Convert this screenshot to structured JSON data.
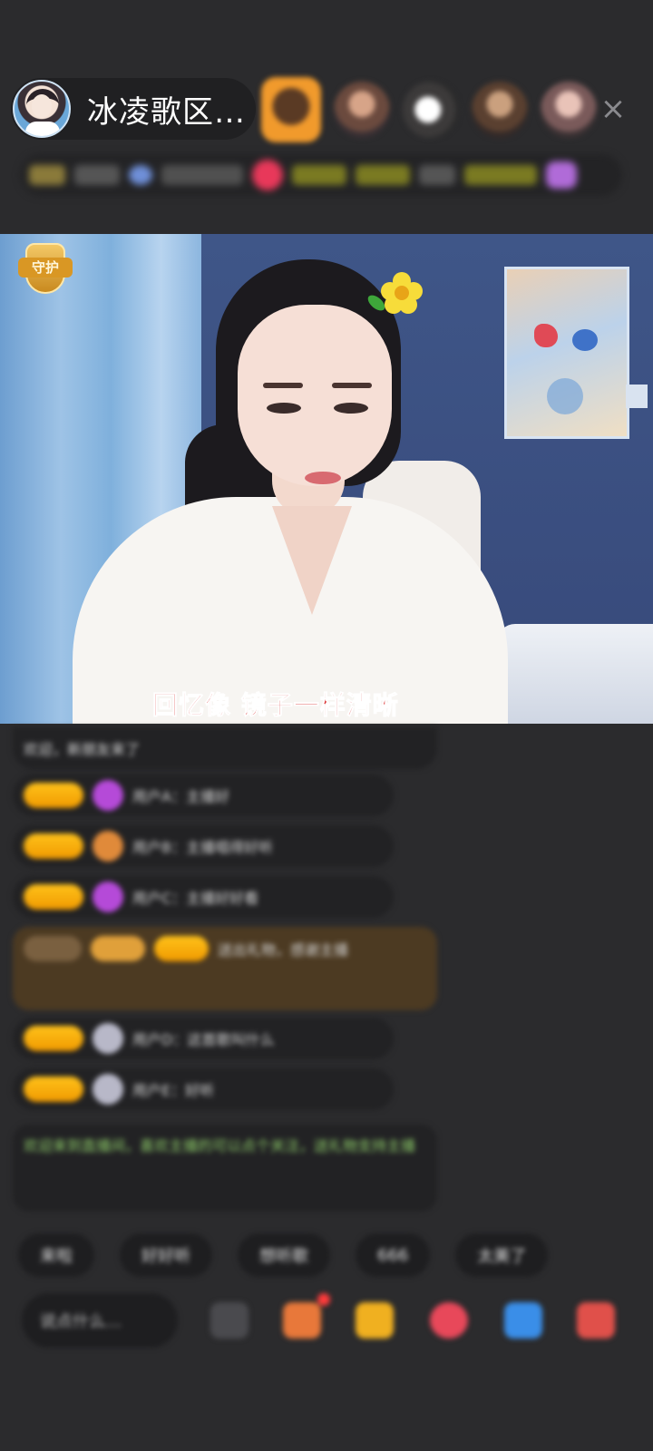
{
  "header": {
    "host_name": "冰凌歌区…",
    "close_glyph": "×"
  },
  "video": {
    "guard_badge_label": "守护",
    "lyric": "回忆像  镜子一样清晰"
  },
  "chat": {
    "messages": [
      "欢迎，新朋友来了",
      "用户A：主播好",
      "用户B：主播唱得好听",
      "用户C：主播好好看",
      "送出礼物，感谢主播",
      "用户D：这首歌叫什么",
      "用户E：好听",
      "欢迎来到直播间，喜欢主播的可以点个关注，送礼物支持主播"
    ]
  },
  "quick_replies": [
    "来啦",
    "好好听",
    "想听歌",
    "666",
    "太美了"
  ],
  "bottom_bar": {
    "say_placeholder": "说点什么…",
    "icons": [
      "more-icon",
      "gift-box-icon",
      "red-packet-icon",
      "heart-icon",
      "share-icon",
      "shop-icon"
    ]
  },
  "colors": {
    "background": "#2b2b2d",
    "badge_orange": "#f5a800",
    "lyric_red": "#d61d1d",
    "green_notice": "#8fce6a"
  }
}
